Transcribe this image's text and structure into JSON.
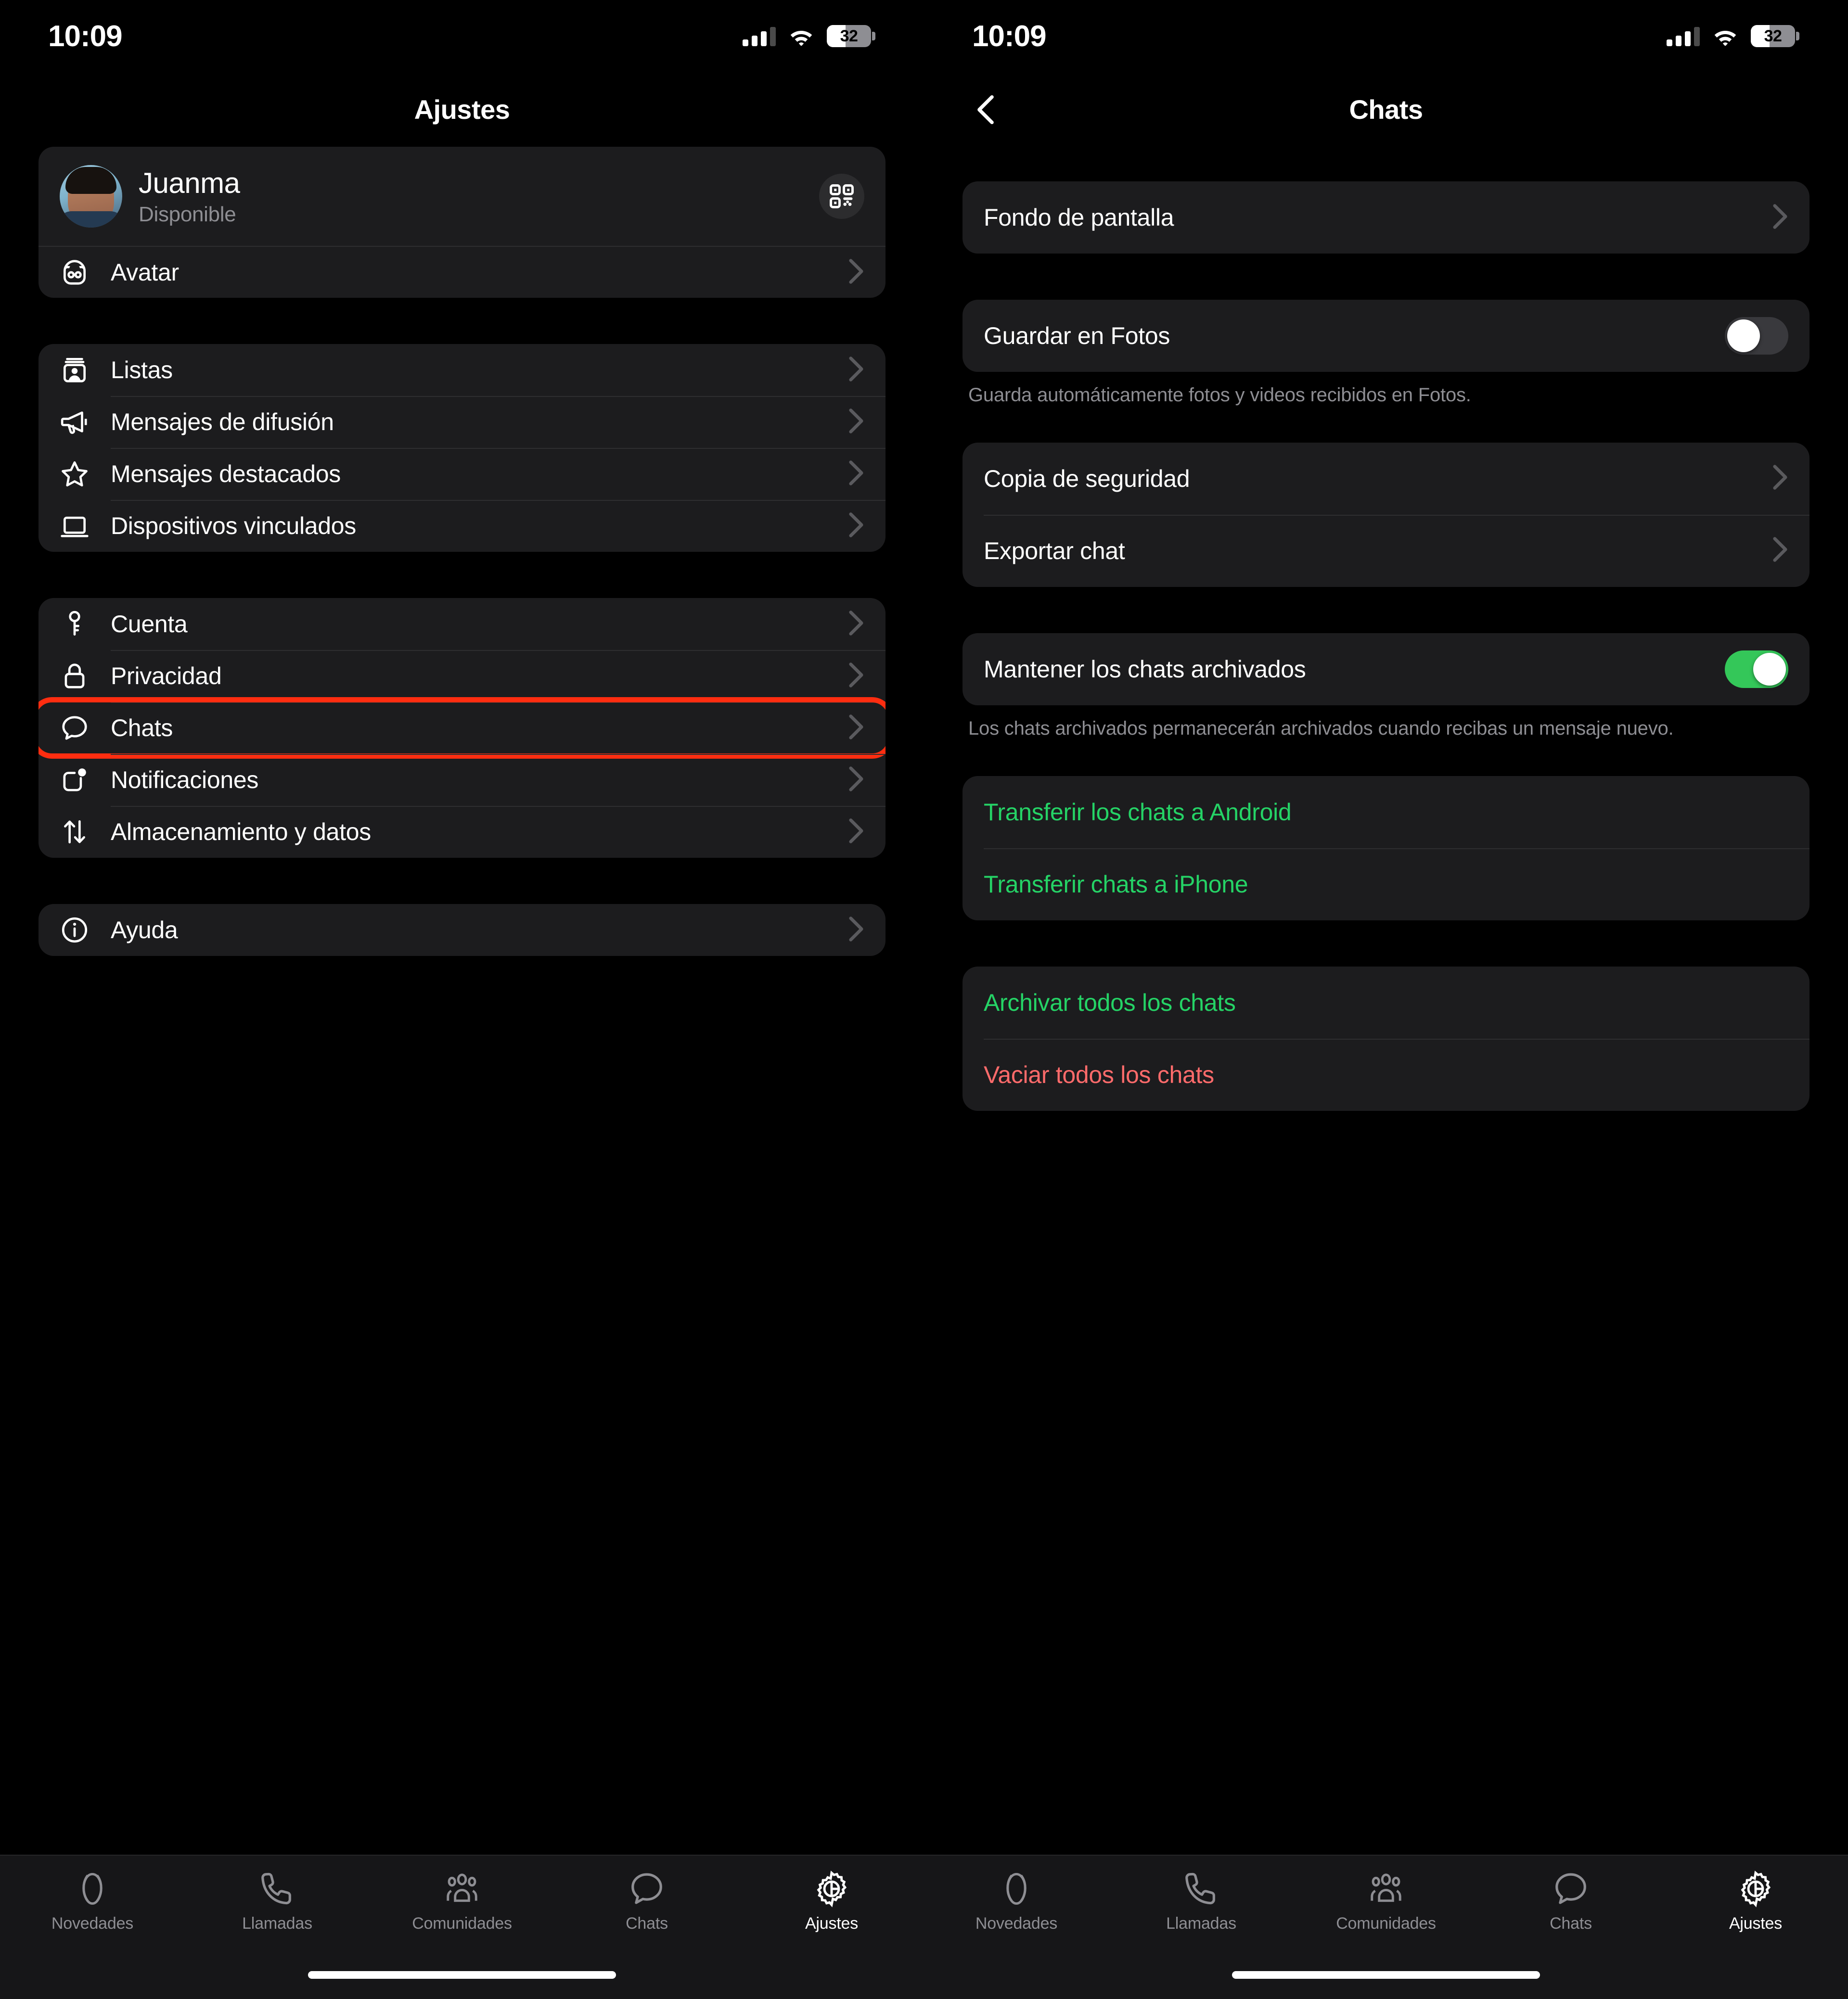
{
  "status_bar": {
    "time": "10:09",
    "battery_percent": "32",
    "signal_icon": "cellular-signal-icon",
    "wifi_icon": "wifi-icon",
    "battery_icon": "battery-icon"
  },
  "left_panel": {
    "title": "Ajustes",
    "profile": {
      "name": "Juanma",
      "status": "Disponible",
      "qr_icon": "qr-code-icon",
      "avatar_icon": "profile-photo"
    },
    "avatar_row": {
      "label": "Avatar",
      "icon": "avatar-face-icon"
    },
    "group_tools": [
      {
        "label": "Listas",
        "icon": "lists-card-icon"
      },
      {
        "label": "Mensajes de difusión",
        "icon": "megaphone-icon"
      },
      {
        "label": "Mensajes destacados",
        "icon": "star-icon"
      },
      {
        "label": "Dispositivos vinculados",
        "icon": "laptop-icon"
      }
    ],
    "group_settings": [
      {
        "label": "Cuenta",
        "icon": "key-icon",
        "highlighted": false
      },
      {
        "label": "Privacidad",
        "icon": "lock-icon",
        "highlighted": false
      },
      {
        "label": "Chats",
        "icon": "chat-bubble-icon",
        "highlighted": true
      },
      {
        "label": "Notificaciones",
        "icon": "notification-badge-icon",
        "highlighted": false
      },
      {
        "label": "Almacenamiento y datos",
        "icon": "arrows-up-down-icon",
        "highlighted": false
      }
    ],
    "group_help": [
      {
        "label": "Ayuda",
        "icon": "info-circle-icon"
      }
    ]
  },
  "right_panel": {
    "title": "Chats",
    "back_icon": "chevron-left-icon",
    "wallpaper_row": {
      "label": "Fondo de pantalla"
    },
    "save_photos": {
      "label": "Guardar en Fotos",
      "toggle_state": "off",
      "footnote": "Guarda automáticamente fotos y videos recibidos en Fotos.",
      "highlighted": true
    },
    "backup_rows": [
      {
        "label": "Copia de seguridad"
      },
      {
        "label": "Exportar chat"
      }
    ],
    "keep_archived": {
      "label": "Mantener los chats archivados",
      "toggle_state": "on",
      "footnote": "Los chats archivados permanecerán archivados cuando recibas un mensaje nuevo."
    },
    "transfer_rows": [
      {
        "label": "Transferir los chats a Android",
        "tone": "green"
      },
      {
        "label": "Transferir chats a iPhone",
        "tone": "green"
      }
    ],
    "bulk_rows": [
      {
        "label": "Archivar todos los chats",
        "tone": "green"
      },
      {
        "label": "Vaciar todos los chats",
        "tone": "red"
      }
    ]
  },
  "tabbar": {
    "items": [
      {
        "label": "Novedades",
        "icon": "status-rings-icon",
        "active": false
      },
      {
        "label": "Llamadas",
        "icon": "phone-icon",
        "active": false
      },
      {
        "label": "Comunidades",
        "icon": "communities-people-icon",
        "active": false
      },
      {
        "label": "Chats",
        "icon": "chat-bubble-icon",
        "active": false
      },
      {
        "label": "Ajustes",
        "icon": "gear-icon",
        "active": true
      }
    ]
  },
  "colors": {
    "accent_green": "#25D366",
    "toggle_on": "#34C759",
    "destructive_red": "#FF6B6B",
    "highlight_ring": "#FF2D10",
    "card_bg": "#1C1C1E",
    "page_bg": "#000000",
    "secondary_text": "#8E8E93"
  }
}
